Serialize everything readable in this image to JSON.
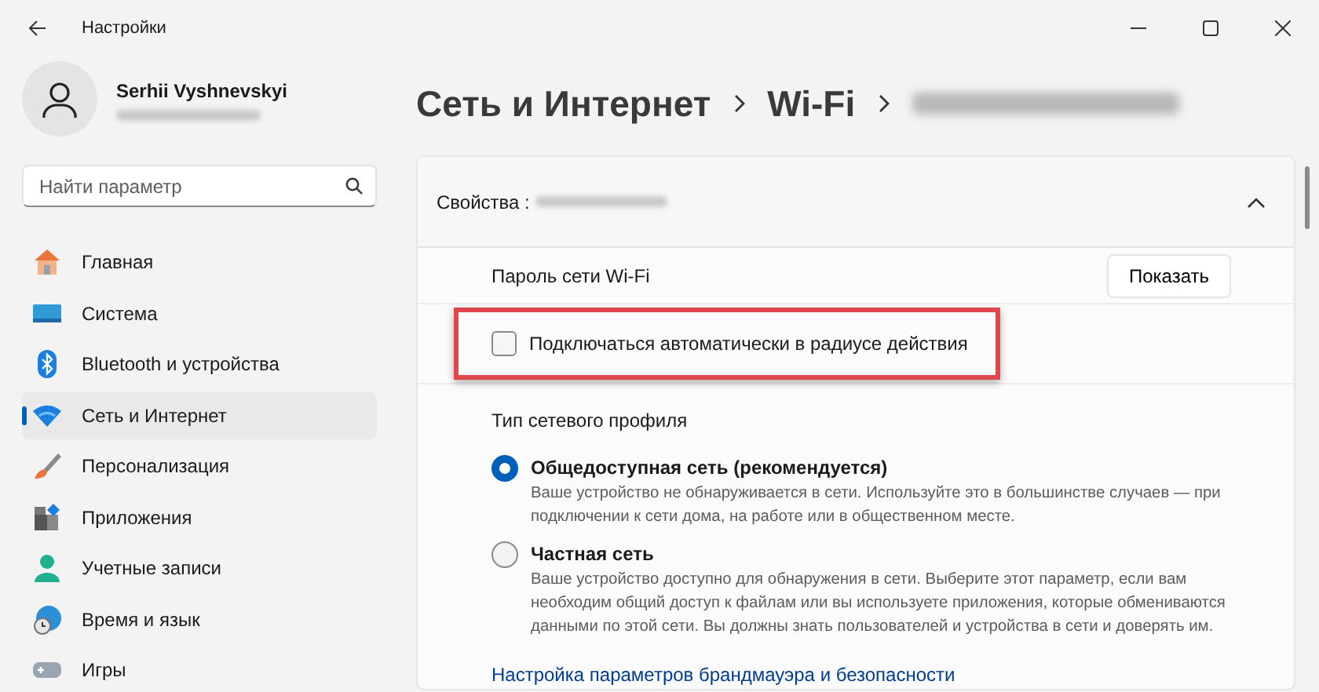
{
  "window": {
    "title": "Настройки"
  },
  "profile": {
    "name": "Serhii Vyshnevskyi"
  },
  "search": {
    "placeholder": "Найти параметр"
  },
  "nav": [
    {
      "label": "Главная",
      "selected": false
    },
    {
      "label": "Система",
      "selected": false
    },
    {
      "label": "Bluetooth и устройства",
      "selected": false
    },
    {
      "label": "Сеть и Интернет",
      "selected": true
    },
    {
      "label": "Персонализация",
      "selected": false
    },
    {
      "label": "Приложения",
      "selected": false
    },
    {
      "label": "Учетные записи",
      "selected": false
    },
    {
      "label": "Время и язык",
      "selected": false
    },
    {
      "label": "Игры",
      "selected": false
    }
  ],
  "breadcrumb": [
    "Сеть и Интернет",
    "Wi-Fi"
  ],
  "card": {
    "title": "Свойства :",
    "expanded": true,
    "password_label": "Пароль сети Wi-Fi",
    "show_button": "Показать",
    "auto_connect": {
      "label": "Подключаться автоматически в радиусе действия",
      "checked": false,
      "highlighted": true
    },
    "profile_heading": "Тип сетевого профиля",
    "profile_options": [
      {
        "label": "Общедоступная сеть (рекомендуется)",
        "description": "Ваше устройство не обнаруживается в сети. Используйте это в большинстве случаев — при подключении к сети дома, на работе или в общественном месте.",
        "selected": true
      },
      {
        "label": "Частная сеть",
        "description": "Ваше устройство доступно для обнаружения в сети. Выберите этот параметр, если вам необходим общий доступ к файлам или вы используете приложения, которые обмениваются данными по этой сети. Вы должны знать пользователей и устройства в сети и доверять им.",
        "selected": false
      }
    ],
    "link": "Настройка параметров брандмауэра и безопасности"
  }
}
